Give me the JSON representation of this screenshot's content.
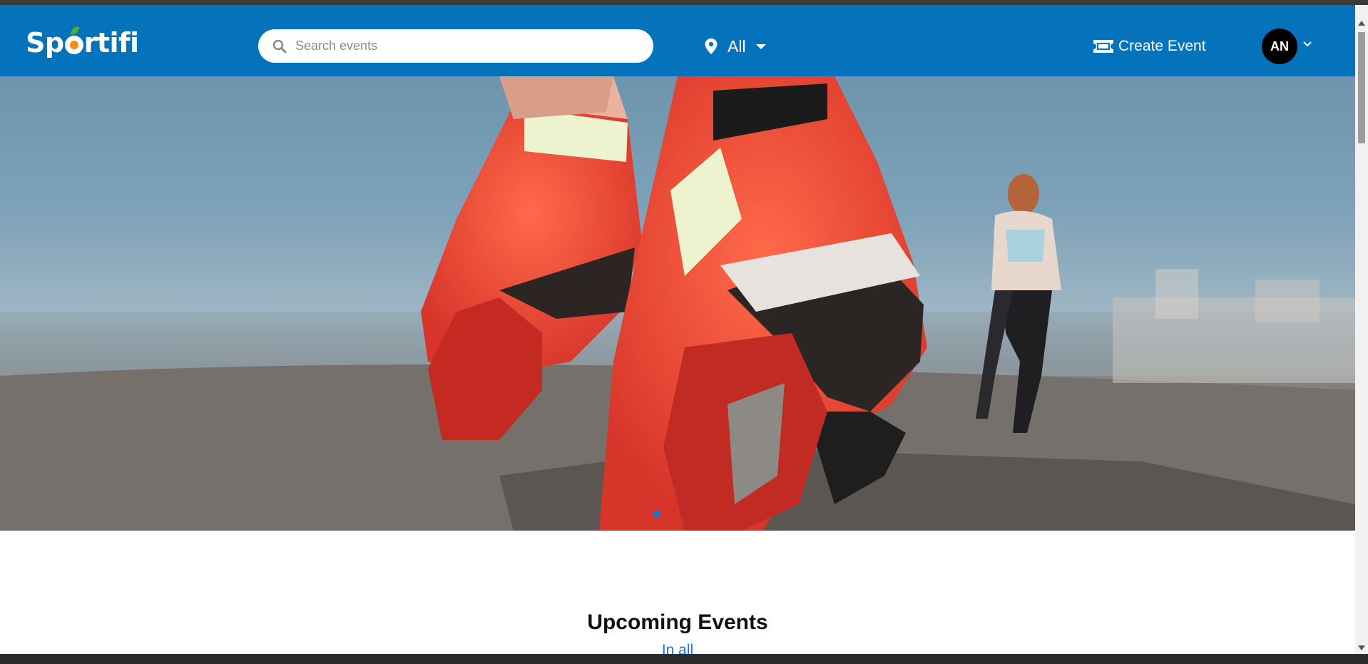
{
  "brand": {
    "name": "Sportifi",
    "before_mark": "Sp",
    "after_mark": "rtifi"
  },
  "search": {
    "placeholder": "Search events",
    "value": ""
  },
  "location": {
    "selected": "All"
  },
  "nav": {
    "create_event_label": "Create Event"
  },
  "user": {
    "initials": "AN"
  },
  "hero": {
    "active_slide": 1,
    "slide_count": 1,
    "image": "running shoes on a waterfront promenade with a jogger in the background"
  },
  "main": {
    "section_title": "Upcoming Events",
    "section_subtitle": "In all"
  },
  "colors": {
    "navbar": "#0573bb",
    "accent": "#1a73d9",
    "avatar": "#000000"
  },
  "icons": {
    "search": "search-icon",
    "location": "location-pin-icon",
    "location_caret": "caret-down-icon",
    "create_event": "ticket-icon",
    "avatar_caret": "chevron-down-icon"
  }
}
